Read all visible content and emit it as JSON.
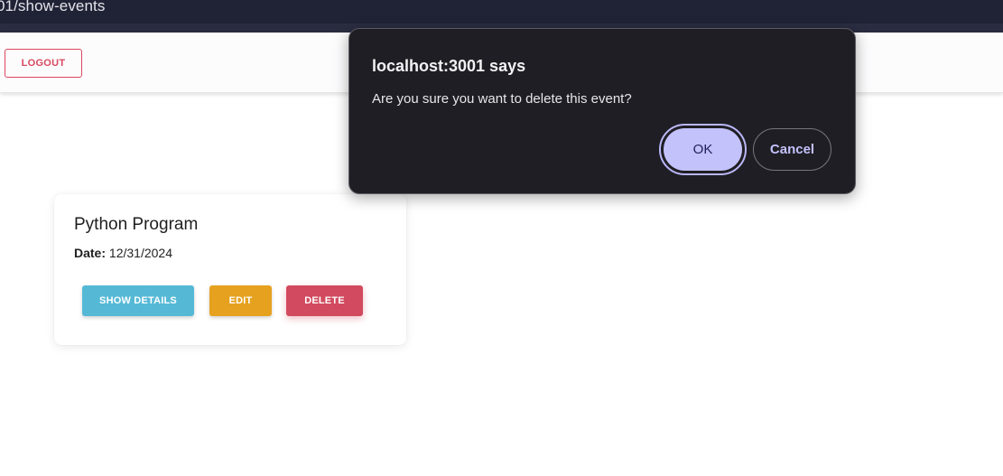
{
  "browser": {
    "url_fragment": "01/show-events"
  },
  "header": {
    "logout_label": "LOGOUT"
  },
  "event": {
    "title": "Python Program",
    "date_label": "Date:",
    "date_value": "12/31/2024",
    "show_details_label": "SHOW DETAILS",
    "edit_label": "EDIT",
    "delete_label": "DELETE"
  },
  "dialog": {
    "title": "localhost:3001 says",
    "message": "Are you sure you want to delete this event?",
    "ok_label": "OK",
    "cancel_label": "Cancel"
  },
  "colors": {
    "show_details": "#55b9d6",
    "edit": "#e6a11e",
    "delete": "#d24a5f",
    "logout": "#d9485f",
    "dialog_bg": "#1f1e24",
    "ok_bg": "#c4c2fb"
  }
}
